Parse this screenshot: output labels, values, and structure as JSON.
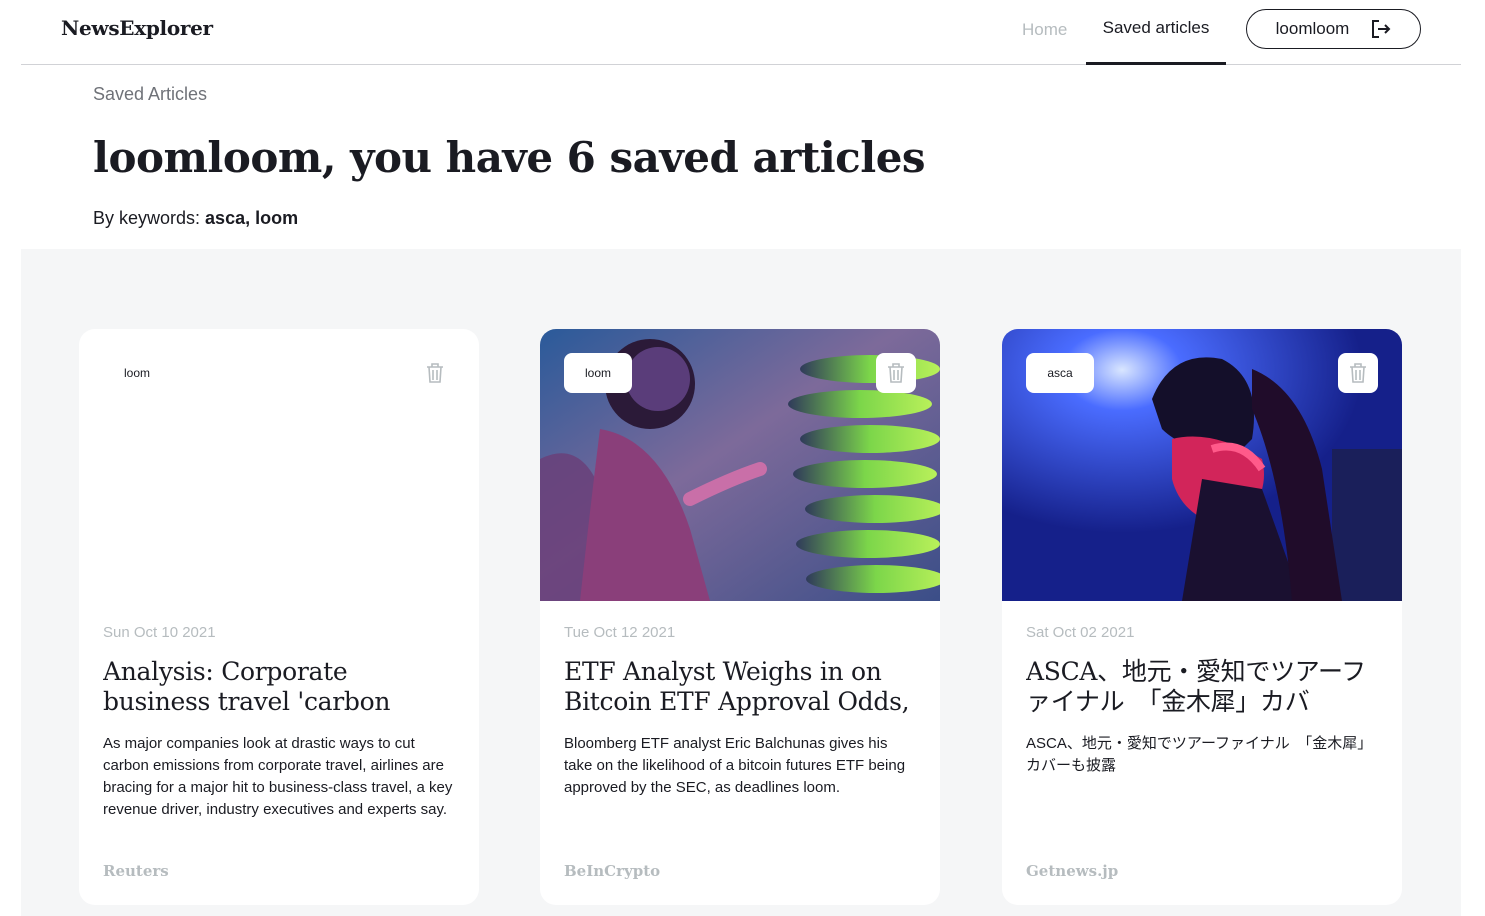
{
  "header": {
    "logo": "NewsExplorer",
    "nav_home": "Home",
    "nav_saved": "Saved articles",
    "user_name": "loomloom"
  },
  "page": {
    "label": "Saved Articles",
    "title": "loomloom, you have 6 saved articles",
    "keywords_prefix": "By keywords: ",
    "keywords": "asca, loom"
  },
  "cards": [
    {
      "keyword": "loom",
      "has_image": false,
      "date": "Sun Oct 10 2021",
      "title": "Analysis: Corporate business travel 'carbon",
      "text": "As major companies look at drastic ways to cut carbon emissions from corporate travel, airlines are bracing for a major hit to business-class travel, a key revenue driver, industry executives and experts say.",
      "source": "Reuters"
    },
    {
      "keyword": "loom",
      "has_image": true,
      "date": "Tue Oct 12 2021",
      "title": "ETF Analyst Weighs in on Bitcoin ETF Approval Odds,",
      "text": "Bloomberg ETF analyst Eric Balchunas gives his take on the likelihood of a bitcoin futures ETF being approved by the SEC, as deadlines loom.",
      "source": "BeInCrypto"
    },
    {
      "keyword": "asca",
      "has_image": true,
      "date": "Sat Oct 02 2021",
      "title": "ASCA、地元・愛知でツアーファイナル　「金木犀」カバ",
      "text": "ASCA、地元・愛知でツアーファイナル　「金木犀」カバーも披露",
      "source": "Getnews.jp"
    }
  ]
}
